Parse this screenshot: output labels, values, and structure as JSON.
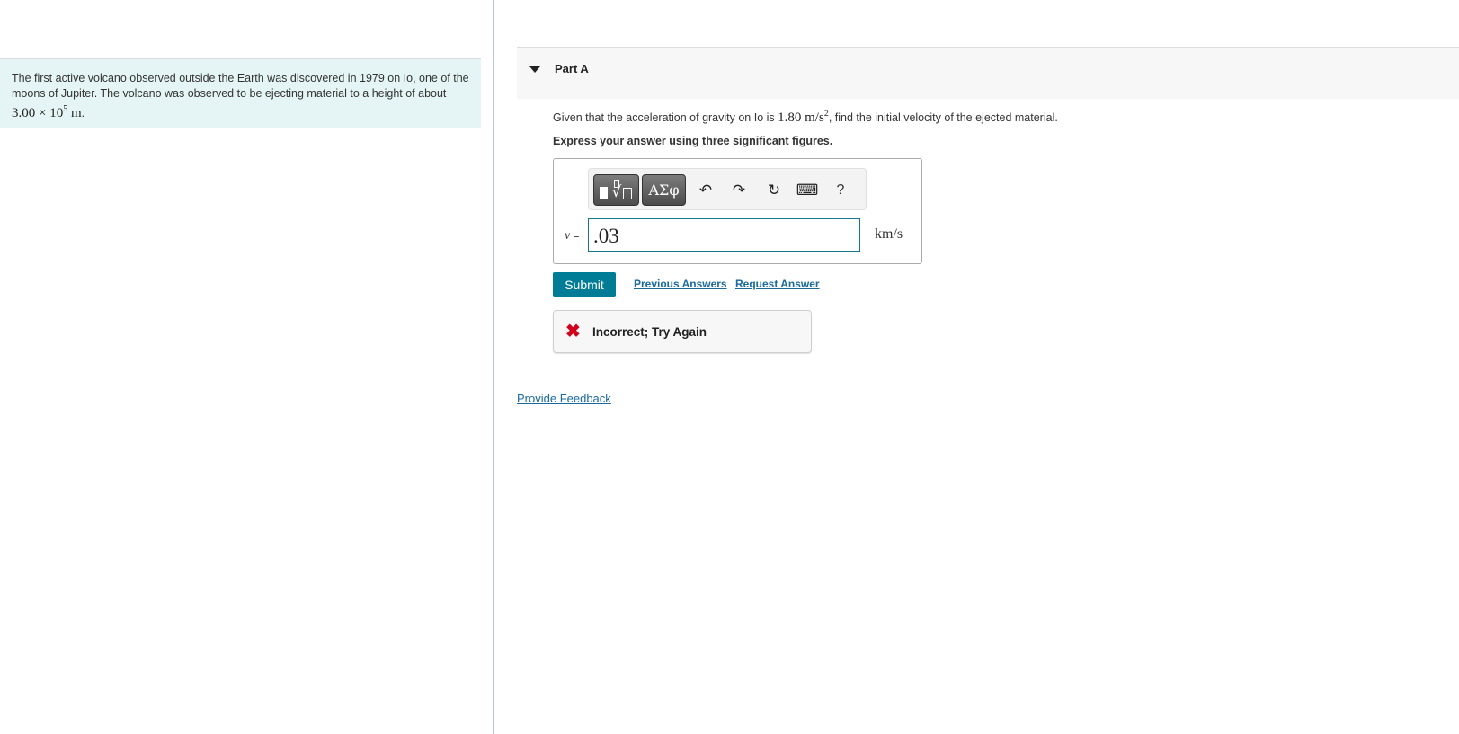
{
  "intro": {
    "text_before": "The first active volcano observed outside the Earth was discovered in 1979 on Io, one of the moons of Jupiter. The volcano was observed to be ejecting material to a height of about ",
    "height_coefficient": "3.00",
    "times_symbol": "×",
    "height_base": "10",
    "height_exponent": "5",
    "height_unit": "m",
    "text_after": "."
  },
  "part": {
    "title": "Part A",
    "question_before": "Given that the acceleration of gravity on Io is ",
    "gravity_value": "1.80",
    "gravity_unit": "m/s",
    "gravity_unit_exponent": "2",
    "question_after": ", find the initial velocity of the ejected material.",
    "instruction": "Express your answer using three significant figures."
  },
  "toolbar": {
    "symbols_label": "ΑΣφ",
    "undo_glyph": "↶",
    "redo_glyph": "↷",
    "reset_glyph": "↻",
    "keyboard_glyph": "⌨",
    "help_label": "?"
  },
  "answer": {
    "variable": "v",
    "equals": " =",
    "value": ".03",
    "unit": "km/s"
  },
  "actions": {
    "submit_label": "Submit",
    "previous_answers_label": "Previous Answers",
    "request_answer_label": "Request Answer"
  },
  "feedback": {
    "icon_glyph": "✖",
    "message": "Incorrect; Try Again",
    "status_color": "#d0021b"
  },
  "footer": {
    "provide_feedback_label": "Provide Feedback"
  },
  "colors": {
    "accent": "#007c97",
    "intro_background": "#e5f5f6",
    "link": "#1a6a9c"
  }
}
